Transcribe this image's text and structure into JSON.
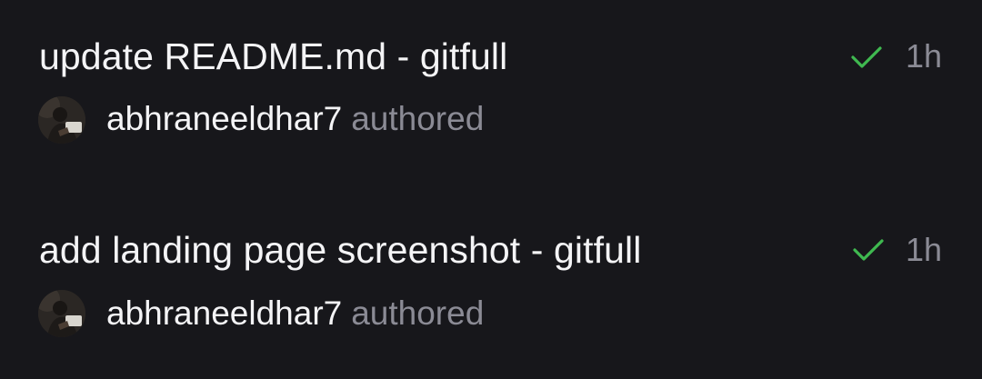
{
  "commits": [
    {
      "title": "update README.md - gitfull",
      "status": "success",
      "status_icon": "check-icon",
      "status_color": "#3fb950",
      "time": "1h",
      "author": "abhraneeldhar7",
      "verb": "authored"
    },
    {
      "title": "add landing page screenshot - gitfull",
      "status": "success",
      "status_icon": "check-icon",
      "status_color": "#3fb950",
      "time": "1h",
      "author": "abhraneeldhar7",
      "verb": "authored"
    }
  ]
}
